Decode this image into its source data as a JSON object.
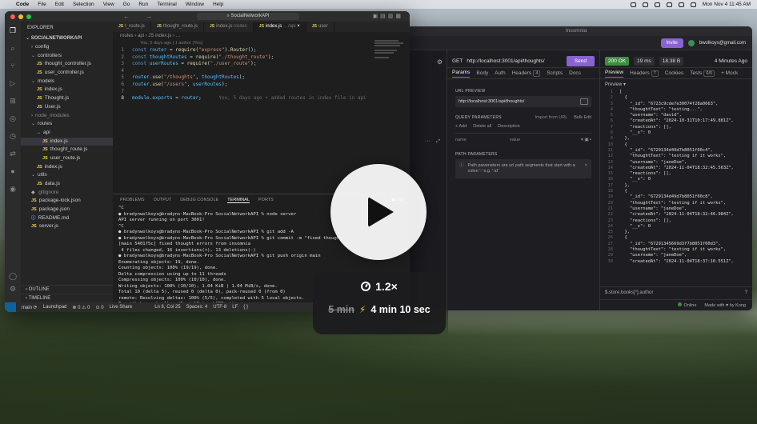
{
  "menubar": {
    "app": "Code",
    "items": [
      "File",
      "Edit",
      "Selection",
      "View",
      "Go",
      "Run",
      "Terminal",
      "Window",
      "Help"
    ],
    "clock": "Mon Nov 4  11:45 AM"
  },
  "vscode": {
    "search": "SocialNetworkAPI",
    "explorer_title": "EXPLORER",
    "project": "SOCIALNETWORKAPI",
    "tree": [
      {
        "label": "config",
        "kind": "folder-closed",
        "depth": 1
      },
      {
        "label": "controllers",
        "kind": "folder-open",
        "depth": 1
      },
      {
        "label": "thought_controller.js",
        "kind": "js",
        "depth": 2
      },
      {
        "label": "user_controller.js",
        "kind": "js",
        "depth": 2
      },
      {
        "label": "models",
        "kind": "folder-open",
        "depth": 1
      },
      {
        "label": "index.js",
        "kind": "js",
        "depth": 2
      },
      {
        "label": "Thought.js",
        "kind": "js",
        "depth": 2
      },
      {
        "label": "User.js",
        "kind": "js",
        "depth": 2
      },
      {
        "label": "node_modules",
        "kind": "folder-closed-dim",
        "depth": 1
      },
      {
        "label": "routes",
        "kind": "folder-open",
        "depth": 1
      },
      {
        "label": "api",
        "kind": "folder-open",
        "depth": 2
      },
      {
        "label": "index.js",
        "kind": "js-selected",
        "depth": 3
      },
      {
        "label": "thought_route.js",
        "kind": "js",
        "depth": 3
      },
      {
        "label": "user_route.js",
        "kind": "js",
        "depth": 3
      },
      {
        "label": "index.js",
        "kind": "js",
        "depth": 2
      },
      {
        "label": "utils",
        "kind": "folder-open",
        "depth": 1
      },
      {
        "label": "data.js",
        "kind": "js",
        "depth": 2
      },
      {
        "label": ".gitignore",
        "kind": "file-dim",
        "depth": 1
      },
      {
        "label": "package-lock.json",
        "kind": "json",
        "depth": 1
      },
      {
        "label": "package.json",
        "kind": "json",
        "depth": 1
      },
      {
        "label": "README.md",
        "kind": "md",
        "depth": 1
      },
      {
        "label": "server.js",
        "kind": "js",
        "depth": 1
      }
    ],
    "outline": "OUTLINE",
    "timeline": "TIMELINE",
    "tabs": [
      {
        "label": "t_route.js",
        "hint": "",
        "active": false
      },
      {
        "label": "thought_route.js",
        "hint": "",
        "active": false
      },
      {
        "label": "index.js",
        "hint": "routes",
        "active": false
      },
      {
        "label": "index.js",
        "hint": "…/api",
        "active": true
      },
      {
        "label": "user",
        "hint": "",
        "active": false
      }
    ],
    "breadcrumb": "routes › api › JS index.js › …",
    "blame_header": "You, 5 days ago | 1 author (You)",
    "code": [
      {
        "n": "1",
        "t": "const router = require(\"express\").Router();"
      },
      {
        "n": "2",
        "t": "const thoughtRoutes = require(\"./thought_route\");"
      },
      {
        "n": "3",
        "t": "const userRoutes = require(\"./user_route\");"
      },
      {
        "n": "4",
        "t": ""
      },
      {
        "n": "5",
        "t": "router.use(\"/thoughts\", thoughtRoutes);"
      },
      {
        "n": "6",
        "t": "router.use(\"/users\", userRoutes);"
      },
      {
        "n": "7",
        "t": ""
      },
      {
        "n": "8",
        "t": "module.exports = router;"
      }
    ],
    "blame_inline": "You, 5 days ago • added routes in index file in api",
    "panel_tabs": [
      "PROBLEMS",
      "OUTPUT",
      "DEBUG CONSOLE",
      "TERMINAL",
      "PORTS"
    ],
    "panel_active": "TERMINAL",
    "terminal_label": "zsh",
    "terminal": [
      "^C",
      "● bradynwolkoys@bradyns-MacBook-Pro SocialNetworkAPI % node server",
      "API server running on port 3001!",
      "^C",
      "● bradynwolkoys@bradyns-MacBook-Pro SocialNetworkAPI % git add -A",
      "● bradynwolkoys@bradyns-MacBook-Pro SocialNetworkAPI % git commit -m \"fixed thought",
      "[main 5401f5c] fixed thought errors from insomnia",
      " 4 files changed, 16 insertions(+), 13 deletions(-)",
      "● bradynwolkoys@bradyns-MacBook-Pro SocialNetworkAPI % git push origin main",
      "Enumerating objects: 19, done.",
      "Counting objects: 100% (19/19), done.",
      "Delta compression using up to 11 threads",
      "Compressing objects: 100% (10/10), done.",
      "Writing objects: 100% (10/10), 1.04 KiB | 1.04 MiB/s, done.",
      "Total 10 (delta 5), reused 0 (delta 0), pack-reused 0 (from 0)",
      "remote: Resolving deltas: 100% (5/5), completed with 5 local objects.",
      "To github.com:bwolkoys/SocialNetworkAPI.git",
      "   e26f61e..5401f5c  main -> main",
      "● bradynwolkoys@bradyns-MacBook-Pro SocialNetworkAPI % node server"
    ],
    "status": {
      "branch": "main ⟳",
      "launchpad": "Launchpad",
      "problems": "⊗ 0 ⚠ 0",
      "ports": "⊙ 0",
      "live": "Live Share",
      "pos": "Ln 8, Col 25",
      "spaces": "Spaces: 4",
      "enc": "UTF-8",
      "eol": "LF",
      "braces": "{ }"
    }
  },
  "insomnia": {
    "title": "Insomnia",
    "invite": "Invite",
    "account": "bwolkoys@gmail.com",
    "method": "GET",
    "url": "http://localhost:3001/api/thoughts/",
    "send": "Send",
    "req_tabs": [
      {
        "label": "Params",
        "count": "",
        "active": true
      },
      {
        "label": "Body",
        "count": "",
        "active": false
      },
      {
        "label": "Auth",
        "count": "",
        "active": false
      },
      {
        "label": "Headers",
        "count": "4",
        "active": false
      },
      {
        "label": "Scripts",
        "count": "",
        "active": false
      },
      {
        "label": "Docs",
        "count": "",
        "active": false
      }
    ],
    "url_preview_label": "URL PREVIEW",
    "url_preview": "http://localhost:3001/api/thoughts/",
    "query_label": "QUERY PARAMETERS",
    "import_from_url": "Import from URL",
    "bulk_edit": "Bulk Edit",
    "add": "+ Add",
    "delete_all": "Delete all",
    "description": "Description",
    "name_ph": "name",
    "value_ph": "value",
    "path_label": "PATH PARAMETERS",
    "path_info": "Path parameters are url path segments that start with a colon ':' e.g. ':id'",
    "status_code": "200 OK",
    "time": "19 ms",
    "size": "18.38 B",
    "ago": "4 Minutes Ago",
    "resp_tabs": [
      {
        "label": "Preview",
        "count": "",
        "active": true
      },
      {
        "label": "Headers",
        "count": "7",
        "active": false
      },
      {
        "label": "Cookies",
        "count": "",
        "active": false
      },
      {
        "label": "Tests",
        "count": "0/0",
        "active": false
      },
      {
        "label": "+ Mock",
        "count": "",
        "active": false
      }
    ],
    "preview_mode": "Preview ▾",
    "json": [
      {
        "n": "1",
        "t": "["
      },
      {
        "n": "2",
        "t": "  {"
      },
      {
        "n": "3",
        "t": "    \"_id\": \"6723c9cde7e30074f28a0663\","
      },
      {
        "n": "4",
        "t": "    \"thoughtText\": \"testing...\","
      },
      {
        "n": "5",
        "t": "    \"username\": \"david\","
      },
      {
        "n": "6",
        "t": "    \"createdAt\": \"2024-10-31T10:17:49.881Z\","
      },
      {
        "n": "7",
        "t": "    \"reactions\": [],"
      },
      {
        "n": "8",
        "t": "    \"__v\": 0"
      },
      {
        "n": "9",
        "t": "  },"
      },
      {
        "n": "10",
        "t": "  {"
      },
      {
        "n": "11",
        "t": "    \"_id\": \"6729134d49d7b8051f00c4\","
      },
      {
        "n": "12",
        "t": "    \"thoughtText\": \"testing if it works\","
      },
      {
        "n": "13",
        "t": "    \"username\": \"janeDoe\","
      },
      {
        "n": "14",
        "t": "    \"createdAt\": \"2024-11-04T18:32:45.563Z\","
      },
      {
        "n": "15",
        "t": "    \"reactions\": [],"
      },
      {
        "n": "16",
        "t": "    \"__v\": 0"
      },
      {
        "n": "17",
        "t": "  },"
      },
      {
        "n": "18",
        "t": "  {"
      },
      {
        "n": "19",
        "t": "    \"_id\": \"6729134d49d7b8051f00c8\","
      },
      {
        "n": "20",
        "t": "    \"thoughtText\": \"testing if it works\","
      },
      {
        "n": "21",
        "t": "    \"username\": \"janeDoe\","
      },
      {
        "n": "22",
        "t": "    \"createdAt\": \"2024-11-04T18:32:46.984Z\","
      },
      {
        "n": "23",
        "t": "    \"reactions\": [],"
      },
      {
        "n": "24",
        "t": "    \"__v\": 0"
      },
      {
        "n": "25",
        "t": "  },"
      },
      {
        "n": "26",
        "t": "  {"
      },
      {
        "n": "27",
        "t": "    \"_id\": \"67291345669d3f7b8051f00d3\","
      },
      {
        "n": "28",
        "t": "    \"thoughtText\": \"testing if it works\","
      },
      {
        "n": "29",
        "t": "    \"username\": \"janeDoe\","
      },
      {
        "n": "30",
        "t": "    \"createdAt\": \"2024-11-04T18:37:10.551Z\","
      }
    ],
    "filter": "$.store.books[*].author",
    "online": "Online",
    "made_with": "Made with ♥ by Kong"
  },
  "overlay": {
    "rate": "1.2×",
    "original": "5 min",
    "fast": "4 min 10 sec"
  }
}
